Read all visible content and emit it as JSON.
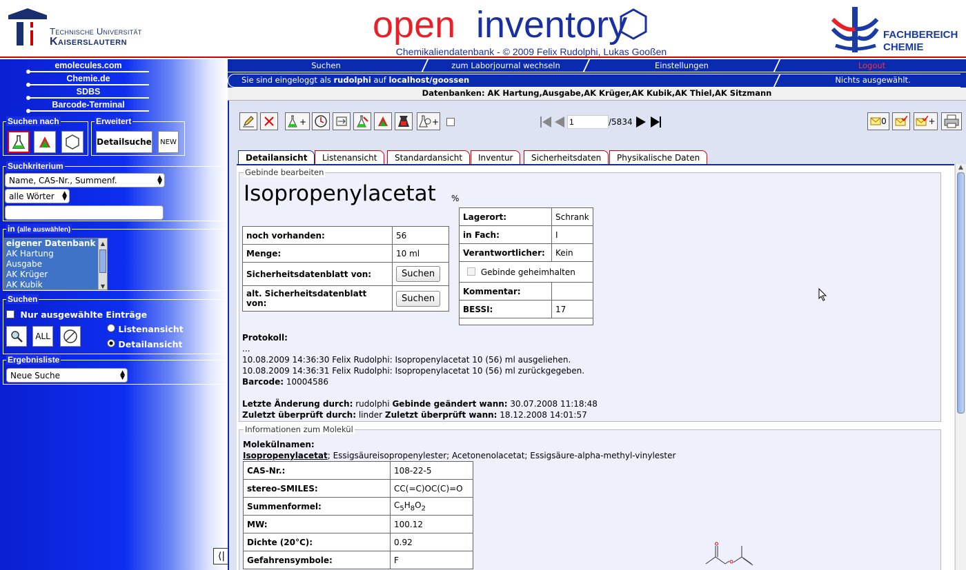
{
  "header": {
    "tu_line1": "Technische Universität",
    "tu_line2": "Kaiserslautern",
    "title_open": "open",
    "title_inventory": "inventory",
    "subtitle": "Chemikaliendatenbank - © 2009 Felix Rudolphi, Lukas Gooßen",
    "fb_line1": "FACHBEREICH",
    "fb_line2": "CHEMIE"
  },
  "sidebar": {
    "links": [
      "emolecules.com",
      "Chemie.de",
      "SDBS",
      "Barcode-Terminal"
    ],
    "suchen_nach": "Suchen nach",
    "erweitert": "Erweitert",
    "detailsuche": "Detailsuche",
    "new": "NEW",
    "suchkriterium": "Suchkriterium",
    "criterion_value": "Name, CAS-Nr., Summenf.",
    "words_value": "alle Wörter",
    "search_value": "",
    "in_label": "in",
    "alle_auswaehlen": "(alle auswählen)",
    "db_list": [
      "eigener Datenbank",
      "AK Hartung",
      "Ausgabe",
      "AK Krüger",
      "AK Kubik"
    ],
    "suchen": "Suchen",
    "nur_ausgewaehlte": "Nur ausgewählte Einträge",
    "all": "ALL",
    "listenansicht": "Listenansicht",
    "detailansicht": "Detailansicht",
    "ergebnisliste": "Ergebnisliste",
    "ergebnis_value": "Neue Suche"
  },
  "nav": {
    "suchen": "Suchen",
    "laborjournal": "zum Laborjournal wechseln",
    "einstellungen": "Einstellungen",
    "logout": "Logout"
  },
  "login": {
    "prefix": "Sie sind eingeloggt als",
    "user": "rudolphi",
    "mid": "auf",
    "host": "localhost/goossen",
    "nichts": "Nichts ausgewählt."
  },
  "databases": "Datenbanken: AK Hartung,Ausgabe,AK Krüger,AK Kubik,AK Thiel,AK Sitzmann",
  "toolbar": {
    "page_value": "1",
    "page_total": "/5834",
    "mail_count": "0",
    "plus": "+"
  },
  "tabs": [
    "Detailansicht",
    "Listenansicht",
    "Standardansicht",
    "Inventur",
    "Sicherheitsdaten",
    "Physikalische Daten"
  ],
  "gebinde": {
    "legend": "Gebinde bearbeiten",
    "name": "Isopropenylacetat",
    "percent": "%",
    "left_rows": [
      {
        "k": "noch vorhanden:",
        "v": "56"
      },
      {
        "k": "Menge:",
        "v": "10 ml"
      },
      {
        "k": "Sicherheitsdatenblatt von:",
        "btn": "Suchen"
      },
      {
        "k": "alt. Sicherheitsdatenblatt von:",
        "btn": "Suchen"
      }
    ],
    "right_rows": [
      {
        "k": "Lagerort:",
        "v": "Schrank"
      },
      {
        "k": "in Fach:",
        "v": "I"
      },
      {
        "k": "Verantwortlicher:",
        "v": "Kein"
      }
    ],
    "geheim": "Gebinde geheimhalten",
    "right_rows2": [
      {
        "k": "Kommentar:",
        "v": ""
      },
      {
        "k": "BESSI:",
        "v": "17"
      }
    ],
    "protokoll_label": "Protokoll:",
    "protokoll_dots": "...",
    "protokoll_1": "10.08.2009 14:36:30 Felix Rudolphi: Isopropenylacetat 10 (56) ml ausgeliehen.",
    "protokoll_2": "10.08.2009 14:36:31 Felix Rudolphi: Isopropenylacetat 10 (56) ml zurückgegeben.",
    "barcode_label": "Barcode:",
    "barcode": "10004586",
    "letzte_label": "Letzte Änderung durch:",
    "letzte": "rudolphi",
    "geaendert_label": "Gebinde geändert wann:",
    "geaendert": "30.07.2008 11:18:48",
    "ueberprueft_label": "Zuletzt überprüft durch:",
    "ueberprueft": "linder",
    "ueberprueft_wann_label": "Zuletzt überprüft wann:",
    "ueberprueft_wann": "18.12.2008 14:01:57"
  },
  "molekuel": {
    "legend": "Informationen zum Molekül",
    "namen_label": "Molekülnamen:",
    "name_bold": "Isopropenylacetat",
    "names_rest": "; Essigsäureisopropenylester; Acetonenolacetat; Essigsäure-alpha-methyl-vinylester",
    "rows": [
      {
        "k": "CAS-Nr.:",
        "v": "108-22-5"
      },
      {
        "k": "stereo-SMILES:",
        "v": "CC(=C)OC(C)=O"
      },
      {
        "k": "Summenformel:",
        "v": "C5H8O2"
      },
      {
        "k": "MW:",
        "v": "100.12"
      },
      {
        "k": "Dichte (20°C):",
        "v": "0.92"
      },
      {
        "k": "Gefahrensymbole:",
        "v": "F"
      }
    ]
  },
  "colors": {
    "brand_blue": "#0a2bb0",
    "logout_red": "#ff3030",
    "accent_red": "#cc0000"
  }
}
